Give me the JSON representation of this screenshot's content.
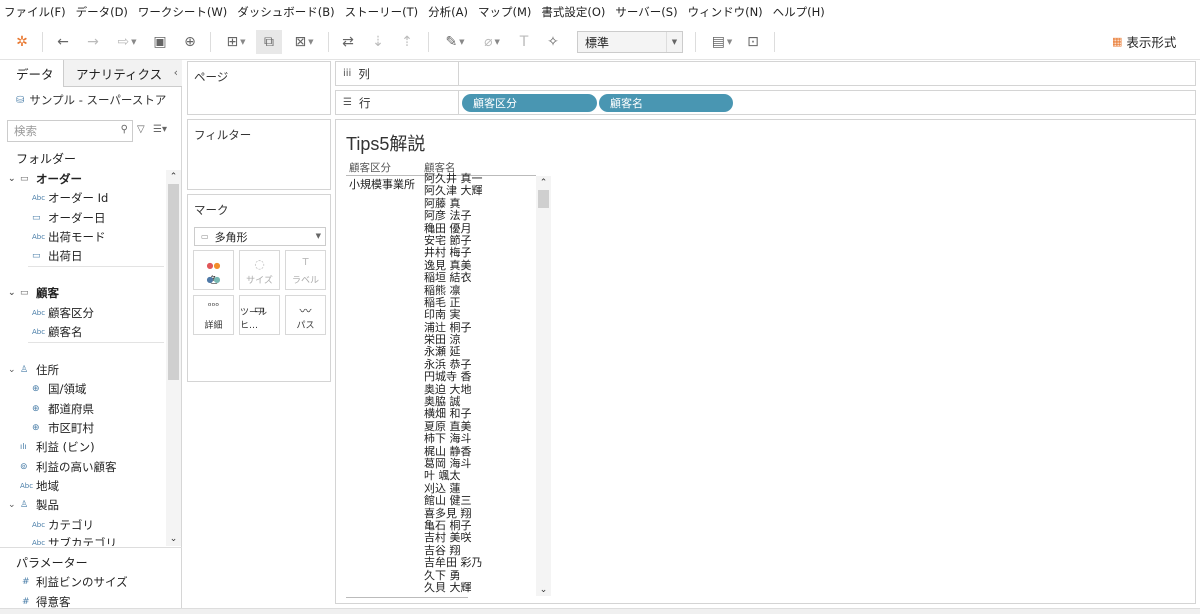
{
  "menu": [
    "ファイル(F)",
    "データ(D)",
    "ワークシート(W)",
    "ダッシュボード(B)",
    "ストーリー(T)",
    "分析(A)",
    "マップ(M)",
    "書式設定(O)",
    "サーバー(S)",
    "ウィンドウ(N)",
    "ヘルプ(H)"
  ],
  "toolbar": {
    "font_select": "標準",
    "show_me": "表示形式"
  },
  "left_pane": {
    "tabs": [
      "データ",
      "アナリティクス"
    ],
    "datasource": "サンプル - スーパーストア",
    "search_placeholder": "検索",
    "folders_label": "フォルダー",
    "fields": [
      {
        "label": "オーダー",
        "kind": "folder"
      },
      {
        "label": "オーダー Id",
        "kind": "abc"
      },
      {
        "label": "オーダー日",
        "kind": "date"
      },
      {
        "label": "出荷モード",
        "kind": "abc"
      },
      {
        "label": "出荷日",
        "kind": "date"
      },
      {
        "label": "顧客",
        "kind": "folder"
      },
      {
        "label": "顧客区分",
        "kind": "abc"
      },
      {
        "label": "顧客名",
        "kind": "abc"
      },
      {
        "label": "住所",
        "kind": "hierarchy"
      },
      {
        "label": "国/領域",
        "kind": "geo"
      },
      {
        "label": "都道府県",
        "kind": "geo"
      },
      {
        "label": "市区町村",
        "kind": "geo"
      },
      {
        "label": "利益 (ビン)",
        "kind": "bin"
      },
      {
        "label": "利益の高い顧客",
        "kind": "set"
      },
      {
        "label": "地域",
        "kind": "abc"
      },
      {
        "label": "製品",
        "kind": "hierarchy"
      },
      {
        "label": "カテゴリ",
        "kind": "abc"
      },
      {
        "label": "サブカテゴリ",
        "kind": "abc"
      }
    ],
    "parameters_label": "パラメーター",
    "parameters": [
      "利益ビンのサイズ",
      "得意客"
    ]
  },
  "cards": {
    "pages": "ページ",
    "filters": "フィルター",
    "marks": "マーク",
    "mark_type": "多角形",
    "mark_buttons": [
      "色",
      "サイズ",
      "ラベル",
      "詳細",
      "ツールヒ…",
      "パス"
    ]
  },
  "shelves": {
    "columns_label": "列",
    "rows_label": "行",
    "row_pills": [
      "顧客区分",
      "顧客名"
    ]
  },
  "view": {
    "title": "Tips5解説",
    "headers": [
      "顧客区分",
      "顧客名"
    ],
    "segment": "小規模事業所",
    "customers": [
      "阿久井 真一",
      "阿久津 大輝",
      "阿藤 真",
      "阿彦 法子",
      "穐田 優月",
      "安宅 節子",
      "井村 梅子",
      "逸見 真美",
      "稲垣 結衣",
      "稲熊 凛",
      "稲毛 正",
      "印南 実",
      "浦辻 桐子",
      "栄田 涼",
      "永瀬 延",
      "永浜 恭子",
      "円城寺 香",
      "奥迫 大地",
      "奥脇 誠",
      "横畑 和子",
      "夏原 直美",
      "柿下 海斗",
      "梶山 静香",
      "葛岡 海斗",
      "叶 颯太",
      "刈込 蓮",
      "館山 健三",
      "喜多見 翔",
      "亀石 桐子",
      "吉村 美咲",
      "吉谷 翔",
      "吉牟田 彩乃",
      "久下 勇",
      "久貝 大輝"
    ]
  },
  "colors": {
    "pill": "#4996b2"
  }
}
